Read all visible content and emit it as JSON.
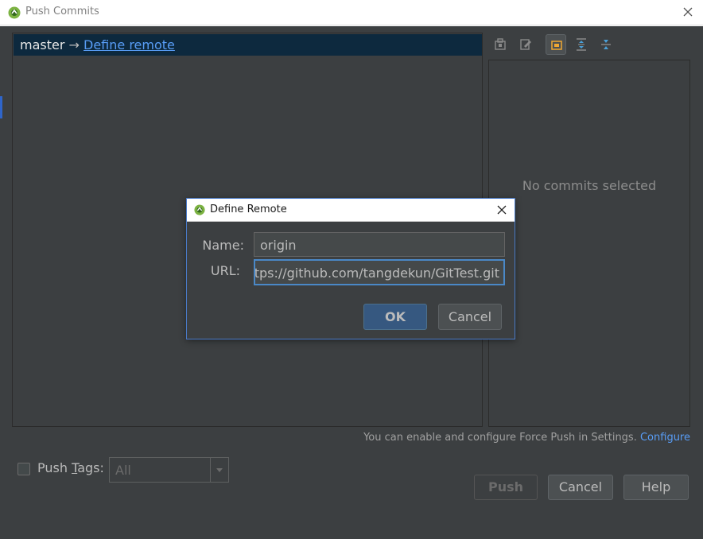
{
  "window": {
    "title": "Push Commits"
  },
  "tree": {
    "branch": "master",
    "arrow": "→",
    "remote_link": "Define remote"
  },
  "toolbar": {
    "icons": [
      "show-repo-icon",
      "edit-icon",
      "group-icon",
      "expand-all-icon",
      "collapse-all-icon"
    ]
  },
  "detail": {
    "empty_text": "No commits selected"
  },
  "force_hint": {
    "text": "You can enable and configure Force Push in Settings.",
    "link": "Configure"
  },
  "push_tags": {
    "label_pre": "Push ",
    "label_mnemonic": "T",
    "label_post": "ags:",
    "combo_value": "All"
  },
  "buttons": {
    "push": "Push",
    "cancel": "Cancel",
    "help": "Help"
  },
  "modal": {
    "title": "Define Remote",
    "name_label": "Name:",
    "name_value": "origin",
    "url_label": "URL:",
    "url_value": "https://github.com/tangdekun/GitTest.git",
    "ok": "OK",
    "cancel": "Cancel"
  },
  "colors": {
    "background": "#3c3f41",
    "selection": "#0d293e",
    "link": "#589df6",
    "accent_border": "#4a88c7",
    "ok_button": "#365880"
  }
}
